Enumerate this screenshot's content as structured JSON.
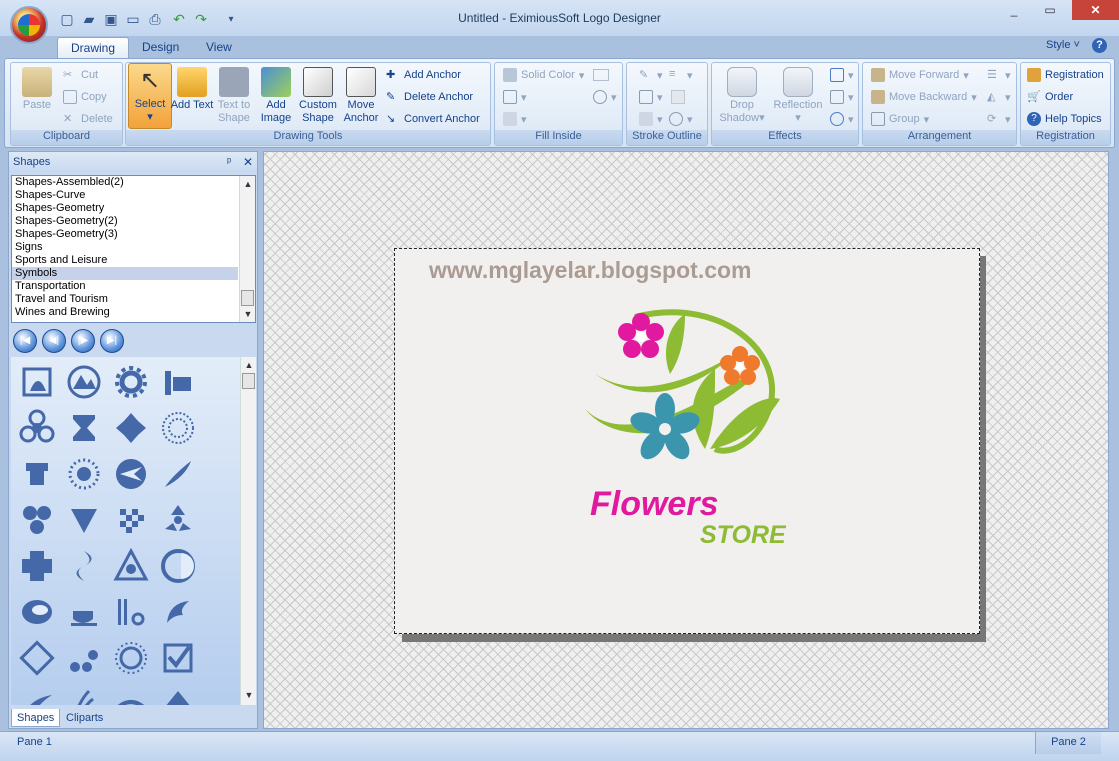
{
  "window": {
    "title": "Untitled - EximiousSoft Logo Designer"
  },
  "tabs": [
    {
      "label": "Drawing"
    },
    {
      "label": "Design"
    },
    {
      "label": "View"
    }
  ],
  "style_menu": "Style",
  "ribbon": {
    "clipboard": {
      "title": "Clipboard",
      "paste": "Paste",
      "cut": "Cut",
      "copy": "Copy",
      "delete": "Delete"
    },
    "drawing_tools": {
      "title": "Drawing Tools",
      "select": "Select",
      "add_text": "Add Text",
      "text_to_shape": "Text to Shape",
      "add_image": "Add Image",
      "custom_shape": "Custom Shape",
      "move_anchor": "Move Anchor",
      "add_anchor": "Add Anchor",
      "delete_anchor": "Delete Anchor",
      "convert_anchor": "Convert Anchor"
    },
    "fill_inside": {
      "title": "Fill Inside",
      "solid_color": "Solid Color"
    },
    "stroke_outline": {
      "title": "Stroke Outline"
    },
    "effects": {
      "title": "Effects",
      "drop_shadow": "Drop Shadow",
      "reflection": "Reflection"
    },
    "arrangement": {
      "title": "Arrangement",
      "move_forward": "Move Forward",
      "move_backward": "Move Backward",
      "group": "Group"
    },
    "registration": {
      "title": "Registration",
      "registration": "Registration",
      "order": "Order",
      "help_topics": "Help Topics"
    }
  },
  "shapes_panel": {
    "title": "Shapes",
    "categories": [
      "Shapes-Assembled(2)",
      "Shapes-Curve",
      "Shapes-Geometry",
      "Shapes-Geometry(2)",
      "Shapes-Geometry(3)",
      "Signs",
      "Sports and Leisure",
      "Symbols",
      "Transportation",
      "Travel and Tourism",
      "Wines and Brewing"
    ],
    "selected_category": "Symbols",
    "bottom_tabs": [
      "Shapes",
      "Cliparts"
    ]
  },
  "canvas": {
    "watermark": "www.mglayelar.blogspot.com",
    "brand_text": "Flowers",
    "sub_text": "STORE",
    "colors": {
      "pink": "#e0199e",
      "green": "#8dbb33",
      "orange": "#ef7a2c",
      "teal": "#3b95ad"
    }
  },
  "status": {
    "pane1": "Pane 1",
    "pane2": "Pane 2"
  }
}
